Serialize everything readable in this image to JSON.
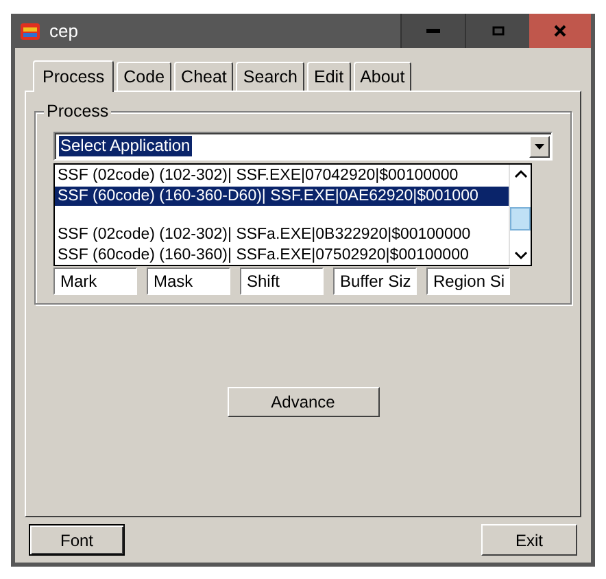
{
  "window": {
    "title": "cep"
  },
  "tabs": [
    {
      "label": "Process",
      "selected": true
    },
    {
      "label": "Code",
      "selected": false
    },
    {
      "label": "Cheat",
      "selected": false
    },
    {
      "label": "Search",
      "selected": false
    },
    {
      "label": "Edit",
      "selected": false
    },
    {
      "label": "About",
      "selected": false
    }
  ],
  "process_group": {
    "label": "Process",
    "combo": {
      "value": "Select Application"
    },
    "list": [
      {
        "kind": "entry",
        "text": "SSF (02code) (102-302)| SSF.EXE|07042920|$00100000",
        "selected": false
      },
      {
        "kind": "entry",
        "text": "SSF (60code) (160-360-D60)| SSF.EXE|0AE62920|$001000",
        "selected": true
      },
      {
        "kind": "blank"
      },
      {
        "kind": "entry",
        "text": "SSF (02code) (102-302)| SSFa.EXE|0B322920|$00100000",
        "selected": false
      },
      {
        "kind": "entry",
        "text": "SSF (60code) (160-360)| SSFa.EXE|07502920|$00100000",
        "selected": false
      }
    ],
    "fields": [
      "Mark",
      "Mask",
      "Shift",
      "Buffer Siz",
      "Region Si"
    ]
  },
  "advance_button": "Advance",
  "font_button": "Font",
  "exit_button": "Exit"
}
